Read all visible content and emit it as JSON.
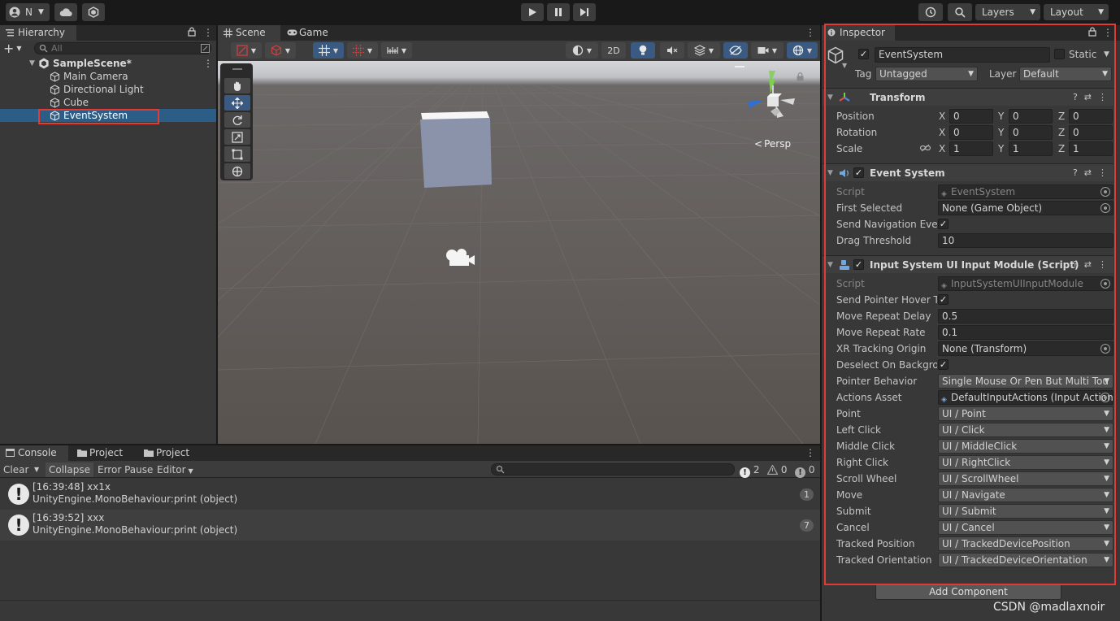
{
  "toolbar": {
    "account_label": "N",
    "layers_label": "Layers",
    "layout_label": "Layout"
  },
  "hierarchy": {
    "tab_label": "Hierarchy",
    "search_placeholder": "All",
    "scene_name": "SampleScene*",
    "items": [
      {
        "label": "Main Camera"
      },
      {
        "label": "Directional Light"
      },
      {
        "label": "Cube"
      },
      {
        "label": "EventSystem"
      }
    ]
  },
  "scene": {
    "tabs": [
      {
        "label": "Scene"
      },
      {
        "label": "Game"
      }
    ],
    "mode_2d_label": "2D",
    "persp_label": "Persp"
  },
  "inspector": {
    "tab_label": "Inspector",
    "object_name": "EventSystem",
    "static_label": "Static",
    "tag_label": "Tag",
    "tag_value": "Untagged",
    "layer_label": "Layer",
    "layer_value": "Default",
    "transform": {
      "title": "Transform",
      "rows": [
        {
          "label": "Position",
          "x": "0",
          "y": "0",
          "z": "0"
        },
        {
          "label": "Rotation",
          "x": "0",
          "y": "0",
          "z": "0"
        },
        {
          "label": "Scale",
          "x": "1",
          "y": "1",
          "z": "1"
        }
      ]
    },
    "event_system": {
      "title": "Event System",
      "script_label": "Script",
      "script_value": "EventSystem",
      "first_selected_label": "First Selected",
      "first_selected_value": "None (Game Object)",
      "send_nav_label": "Send Navigation Even",
      "drag_threshold_label": "Drag Threshold",
      "drag_threshold_value": "10"
    },
    "input_module": {
      "title": "Input System UI Input Module (Script)",
      "script_label": "Script",
      "script_value": "InputSystemUIInputModule",
      "send_hover_label": "Send Pointer Hover To",
      "move_delay_label": "Move Repeat Delay",
      "move_delay_value": "0.5",
      "move_rate_label": "Move Repeat Rate",
      "move_rate_value": "0.1",
      "xr_label": "XR Tracking Origin",
      "xr_value": "None (Transform)",
      "deselect_label": "Deselect On Backgrou",
      "pointer_behavior_label": "Pointer Behavior",
      "pointer_behavior_value": "Single Mouse Or Pen But Multi Tou",
      "actions_asset_label": "Actions Asset",
      "actions_asset_value": "DefaultInputActions (Input Action",
      "bindings": [
        {
          "label": "Point",
          "value": "UI / Point"
        },
        {
          "label": "Left Click",
          "value": "UI / Click"
        },
        {
          "label": "Middle Click",
          "value": "UI / MiddleClick"
        },
        {
          "label": "Right Click",
          "value": "UI / RightClick"
        },
        {
          "label": "Scroll Wheel",
          "value": "UI / ScrollWheel"
        },
        {
          "label": "Move",
          "value": "UI / Navigate"
        },
        {
          "label": "Submit",
          "value": "UI / Submit"
        },
        {
          "label": "Cancel",
          "value": "UI / Cancel"
        },
        {
          "label": "Tracked Position",
          "value": "UI / TrackedDevicePosition"
        },
        {
          "label": "Tracked Orientation",
          "value": "UI / TrackedDeviceOrientation"
        }
      ]
    },
    "add_component_label": "Add Component"
  },
  "console": {
    "tabs": [
      {
        "label": "Console"
      },
      {
        "label": "Project"
      },
      {
        "label": "Project"
      }
    ],
    "clear_label": "Clear",
    "collapse_label": "Collapse",
    "error_pause_label": "Error Pause",
    "editor_label": "Editor",
    "error_count": "2",
    "warning_count": "0",
    "info_count": "0",
    "entries": [
      {
        "line1": "[16:39:48] xx1x",
        "line2": "UnityEngine.MonoBehaviour:print (object)",
        "count": "1"
      },
      {
        "line1": "[16:39:52] xxx",
        "line2": "UnityEngine.MonoBehaviour:print (object)",
        "count": "7"
      }
    ]
  },
  "watermark": "CSDN @madlaxnoir",
  "colors": {
    "highlight_box": "#e53935",
    "selection": "#2c5d87"
  }
}
